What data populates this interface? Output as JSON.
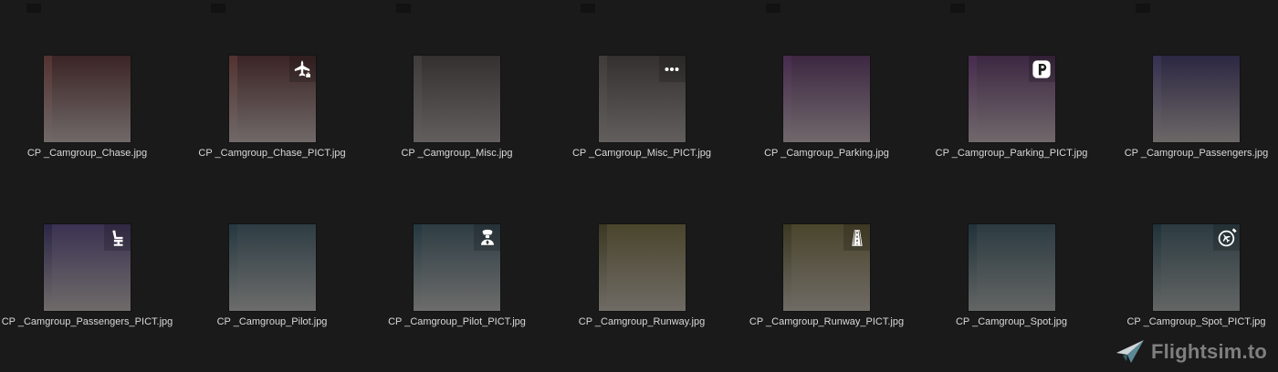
{
  "page": {
    "background": "#1a1a1a",
    "label_color": "#d9d9d9"
  },
  "files": [
    {
      "name": "CP _Camgroup_Chase.jpg",
      "icon": null,
      "colors": {
        "top": "#3b2425",
        "bottom": "#706968",
        "strip": "#533231"
      }
    },
    {
      "name": "CP _Camgroup_Chase_PICT.jpg",
      "icon": "airplane-icon",
      "colors": {
        "top": "#3b2425",
        "bottom": "#706968",
        "strip": "#533231"
      }
    },
    {
      "name": "CP _Camgroup_Misc.jpg",
      "icon": null,
      "colors": {
        "top": "#343030",
        "bottom": "#625e5d",
        "strip": "#403b3b"
      }
    },
    {
      "name": "CP _Camgroup_Misc_PICT.jpg",
      "icon": "ellipsis-icon",
      "colors": {
        "top": "#343030",
        "bottom": "#625e5d",
        "strip": "#403b3b"
      }
    },
    {
      "name": "CP _Camgroup_Parking.jpg",
      "icon": null,
      "colors": {
        "top": "#3d2742",
        "bottom": "#70686b",
        "strip": "#472b4e"
      }
    },
    {
      "name": "CP _Camgroup_Parking_PICT.jpg",
      "icon": "parking-icon",
      "colors": {
        "top": "#3d2742",
        "bottom": "#70686b",
        "strip": "#472b4e"
      }
    },
    {
      "name": "CP _Camgroup_Passengers.jpg",
      "icon": null,
      "colors": {
        "top": "#2c2742",
        "bottom": "#6c6766",
        "strip": "#353050"
      }
    },
    {
      "name": "CP _Camgroup_Passengers_PICT.jpg",
      "icon": "seat-icon",
      "colors": {
        "top": "#3b3252",
        "bottom": "#6f6a69",
        "strip": "#2c2646"
      }
    },
    {
      "name": "CP _Camgroup_Pilot.jpg",
      "icon": null,
      "colors": {
        "top": "#2e3d44",
        "bottom": "#6c6c6b",
        "strip": "#253840"
      }
    },
    {
      "name": "CP _Camgroup_Pilot_PICT.jpg",
      "icon": "pilot-icon",
      "colors": {
        "top": "#2e3d44",
        "bottom": "#6c6c6b",
        "strip": "#253840"
      }
    },
    {
      "name": "CP _Camgroup_Runway.jpg",
      "icon": null,
      "colors": {
        "top": "#4a452c",
        "bottom": "#6f6b65",
        "strip": "#3b3822"
      }
    },
    {
      "name": "CP _Camgroup_Runway_PICT.jpg",
      "icon": "runway-icon",
      "colors": {
        "top": "#4a452c",
        "bottom": "#6f6b65",
        "strip": "#3b3822"
      }
    },
    {
      "name": "CP _Camgroup_Spot.jpg",
      "icon": null,
      "colors": {
        "top": "#2c3b41",
        "bottom": "#636564",
        "strip": "#203239"
      }
    },
    {
      "name": "CP _Camgroup_Spot_PICT.jpg",
      "icon": "spot-view-icon",
      "colors": {
        "top": "#2c3b41",
        "bottom": "#636564",
        "strip": "#203239"
      }
    }
  ],
  "watermark": {
    "label": "Flightsim.to",
    "icon": "paper-plane-icon",
    "colors": {
      "text": "#7f7f7f",
      "plane_light": "#cdd6d9",
      "plane_mid": "#5b8a96",
      "plane_dark": "#39606c"
    }
  }
}
